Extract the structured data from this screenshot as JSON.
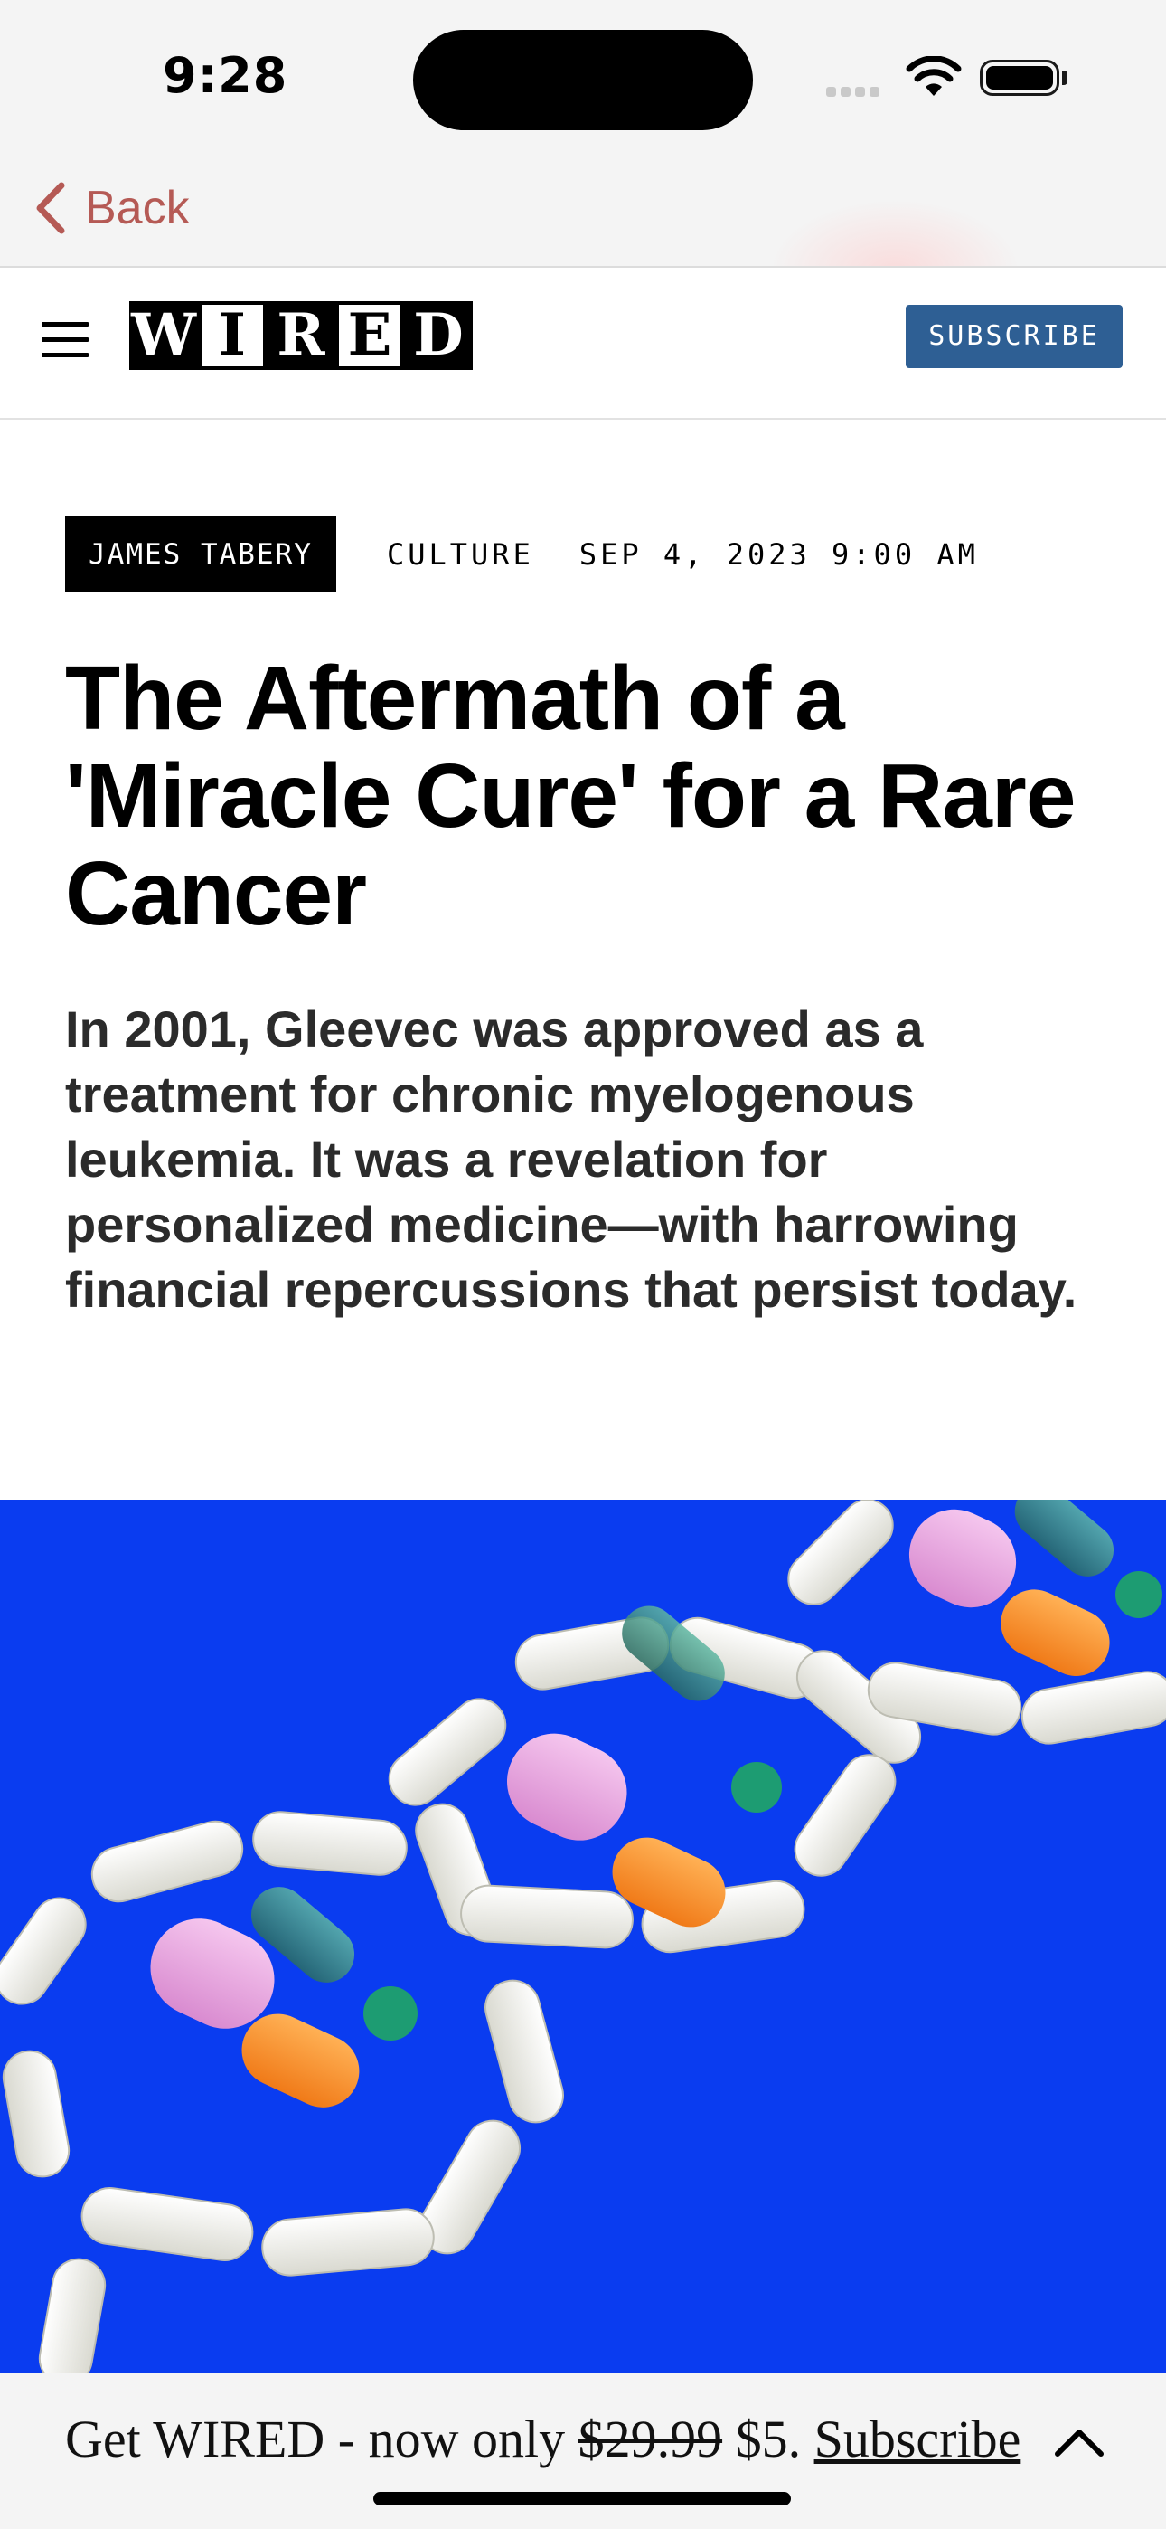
{
  "status_bar": {
    "time": "9:28"
  },
  "nav": {
    "back_label": "Back"
  },
  "header": {
    "logo_letters": [
      "W",
      "I",
      "R",
      "E",
      "D"
    ],
    "subscribe_label": "SUBSCRIBE",
    "subscribe_color": "#2e5f94"
  },
  "article": {
    "author": "JAMES TABERY",
    "category": "CULTURE",
    "date": "SEP 4, 2023 9:00 AM",
    "headline": "The Aftermath of a 'Miracle Cure' for a Rare Cancer",
    "dek": "In 2001, Gleevec was approved as a treatment for chronic myelogenous leukemia. It was a revelation for personalized medicine—with harrowing financial repercussions that persist today."
  },
  "promo": {
    "prefix": "Get WIRED - now only ",
    "old_price": "$29.99",
    "new_price": " $5. ",
    "link_label": "Subscribe"
  },
  "icons": {
    "back": "chevron-left-icon",
    "menu": "hamburger-menu-icon",
    "collapse": "chevron-up-icon"
  },
  "colors": {
    "accent_back": "#b55a55",
    "hero_bg": "#0a3cf0"
  }
}
